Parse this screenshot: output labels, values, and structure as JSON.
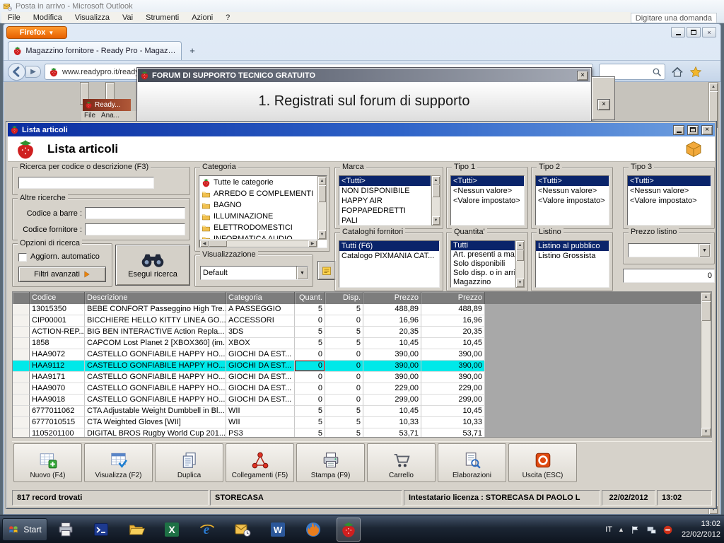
{
  "colors": {
    "selection_cyan": "#00e9e9",
    "selection_navy": "#0a246a",
    "titlebar_blue": "#0b2da0",
    "firefox_orange": "#e66000",
    "table_header_gray": "#7d7d7d"
  },
  "outlook": {
    "title": "Posta in arrivo - Microsoft Outlook",
    "menu": [
      "File",
      "Modifica",
      "Visualizza",
      "Vai",
      "Strumenti",
      "Azioni",
      "?"
    ],
    "question_placeholder": "Digitare una domanda"
  },
  "firefox": {
    "app_button": "Firefox",
    "tab_title": "Magazzino fornitore - Ready Pro - Magazzin...",
    "new_tab": "+",
    "url": "www.readypro.it/ready",
    "background_window": {
      "title": "Ready...",
      "menu": "File   Ana..."
    }
  },
  "dialog": {
    "title": "FORUM DI SUPPORTO TECNICO GRATUITO",
    "message": "1. Registrati sul forum di supporto"
  },
  "app": {
    "title": "Lista articoli",
    "heading": "Lista articoli",
    "filters": {
      "search_group": "Ricerca per codice o descrizione (F3)",
      "search_value": "",
      "other_group": "Altre ricerche",
      "barcode_label": "Codice a barre :",
      "barcode_value": "",
      "supplier_label": "Codice fornitore :",
      "supplier_value": "",
      "options_group": "Opzioni di ricerca",
      "auto_update_label": "Aggiorn. automatico",
      "advanced_button": "Filtri avanzati",
      "search_button": "Esegui ricerca",
      "category_group": "Categoria",
      "view_group": "Visualizzazione",
      "view_value": "Default",
      "marca_group": "Marca",
      "catalog_group": "Cataloghi fornitori",
      "tipo1_group": "Tipo 1",
      "tipo2_group": "Tipo 2",
      "tipo3_group": "Tipo 3",
      "quantity_group": "Quantita'",
      "listino_group": "Listino",
      "price_group": "Prezzo listino",
      "price_value": "",
      "price_amount": "0"
    },
    "category_items": [
      "Tutte le categorie",
      "ARREDO E COMPLEMENTI",
      "BAGNO",
      "ILLUMINAZIONE",
      "ELETTRODOMESTICI",
      "INFORMATICA AUDIO"
    ],
    "lists": {
      "marca": {
        "items": [
          "<Tutti>",
          "NON DISPONIBILE",
          "HAPPY AIR",
          "FOPPAPEDRETTI",
          "PALI"
        ],
        "selected": 0
      },
      "catalog": {
        "items": [
          "Tutti (F6)",
          "Catalogo PIXMANIA CAT..."
        ],
        "selected": 0
      },
      "tipo1": {
        "items": [
          "<Tutti>",
          "<Nessun valore>",
          "<Valore impostato>"
        ],
        "selected": 0
      },
      "tipo2": {
        "items": [
          "<Tutti>",
          "<Nessun valore>",
          "<Valore impostato>"
        ],
        "selected": 0
      },
      "tipo3": {
        "items": [
          "<Tutti>",
          "<Nessun valore>",
          "<Valore impostato>"
        ],
        "selected": 0
      },
      "quantity": {
        "items": [
          "Tutti",
          "Art. presenti a maga...",
          "Solo disponibili",
          "Solo disp. o in arrivo",
          "Magazzino"
        ],
        "selected": 0
      },
      "listino": {
        "items": [
          "Listino al pubblico",
          "Listino Grossista"
        ],
        "selected": 0
      }
    },
    "table": {
      "headers": [
        "",
        "Codice",
        "Descrizione",
        "Categoria",
        "Quant.",
        "Disp.",
        "Prezzo",
        "Prezzo"
      ],
      "selected_row": 5,
      "rows": [
        [
          "13015350",
          "BEBE CONFORT Passeggino High Tre...",
          "A PASSEGGIO",
          "5",
          "5",
          "488,89",
          "488,89"
        ],
        [
          "CIP00001",
          "BICCHIERE HELLO KITTY LINEA GO...",
          "ACCESSORI",
          "0",
          "0",
          "16,96",
          "16,96"
        ],
        [
          "ACTION-REP...",
          "BIG BEN INTERACTIVE Action Repla...",
          "3DS",
          "5",
          "5",
          "20,35",
          "20,35"
        ],
        [
          "1858",
          "CAPCOM Lost Planet 2 [XBOX360] (im...",
          "XBOX",
          "5",
          "5",
          "10,45",
          "10,45"
        ],
        [
          "HAA9072",
          "CASTELLO GONFIABILE HAPPY HO...",
          "GIOCHI DA EST...",
          "0",
          "0",
          "390,00",
          "390,00"
        ],
        [
          "HAA9112",
          "CASTELLO GONFIABILE HAPPY HO...",
          "GIOCHI DA EST...",
          "0",
          "0",
          "390,00",
          "390,00"
        ],
        [
          "HAA9171",
          "CASTELLO GONFIABILE HAPPY HO...",
          "GIOCHI DA EST...",
          "0",
          "0",
          "390,00",
          "390,00"
        ],
        [
          "HAA9070",
          "CASTELLO GONFIABILE HAPPY HO...",
          "GIOCHI DA EST...",
          "0",
          "0",
          "229,00",
          "229,00"
        ],
        [
          "HAA9018",
          "CASTELLO GONFIABILE HAPPY HO...",
          "GIOCHI DA EST...",
          "0",
          "0",
          "299,00",
          "299,00"
        ],
        [
          "6777011062",
          "CTA Adjustable Weight Dumbbell in Bl...",
          "WII",
          "5",
          "5",
          "10,45",
          "10,45"
        ],
        [
          "6777010515",
          "CTA Weighted Gloves [WII]",
          "WII",
          "5",
          "5",
          "10,33",
          "10,33"
        ],
        [
          "1105201100",
          "DIGITAL BROS Rugby World Cup 201...",
          "PS3",
          "5",
          "5",
          "53,71",
          "53,71"
        ]
      ]
    },
    "toolbar": [
      {
        "label": "Nuovo (F4)",
        "icon": "new-grid"
      },
      {
        "label": "Visualizza (F2)",
        "icon": "view-grid"
      },
      {
        "label": "Duplica",
        "icon": "duplicate"
      },
      {
        "label": "Collegamenti (F5)",
        "icon": "links"
      },
      {
        "label": "Stampa (F9)",
        "icon": "print"
      },
      {
        "label": "Carrello",
        "icon": "cart"
      },
      {
        "label": "Elaborazioni",
        "icon": "process"
      },
      {
        "label": "Uscita (ESC)",
        "icon": "exit"
      }
    ],
    "status": {
      "records": "817 record trovati",
      "company": "STORECASA",
      "license": "Intestatario licenza : STORECASA DI PAOLO L",
      "date": "22/02/2012",
      "time": "13:02"
    }
  },
  "taskbar": {
    "start": "Start",
    "apps": [
      "printer",
      "console",
      "folder-open",
      "excel",
      "ie",
      "outlook-app",
      "word",
      "firefox-logo",
      "strawberry"
    ],
    "active_app": 8,
    "tray": {
      "lang": "IT",
      "time": "13:02",
      "date": "22/02/2012"
    }
  }
}
